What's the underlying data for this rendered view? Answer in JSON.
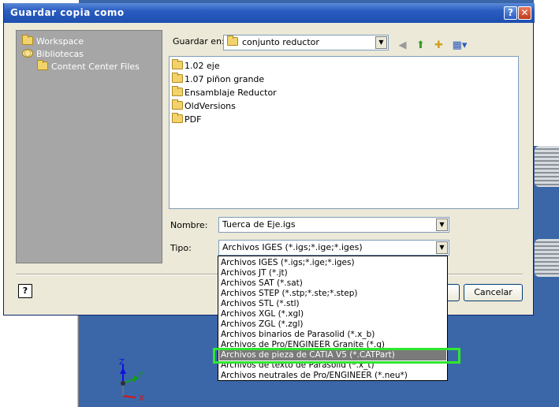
{
  "dialog": {
    "title": "Guardar copia como",
    "help_title_glyph": "?",
    "close_title_glyph": "✕"
  },
  "places": [
    {
      "label": "Workspace",
      "icon": "folder-icon"
    },
    {
      "label": "Bibliotecas",
      "icon": "library-icon"
    },
    {
      "label": "Content Center Files",
      "icon": "folder-icon"
    }
  ],
  "save_in": {
    "label": "Guardar en:",
    "value": "conjunto reductor"
  },
  "toolbar": {
    "back_icon": "back-arrow-icon",
    "up_icon": "up-folder-icon",
    "new_folder_icon": "new-folder-icon",
    "views_icon": "views-menu-icon"
  },
  "files": [
    {
      "name": "1.02 eje"
    },
    {
      "name": "1.07 piñon grande"
    },
    {
      "name": "Ensamblaje Reductor"
    },
    {
      "name": "OldVersions"
    },
    {
      "name": "PDF"
    }
  ],
  "name_field": {
    "label": "Nombre:",
    "value": "Tuerca de Eje.igs"
  },
  "type_field": {
    "label": "Tipo:",
    "value": "Archivos IGES (*.igs;*.ige;*.iges)"
  },
  "type_options": [
    "Archivos IGES (*.igs;*.ige;*.iges)",
    "Archivos JT (*.jt)",
    "Archivos SAT (*.sat)",
    "Archivos STEP (*.stp;*.ste;*.step)",
    "Archivos STL (*.stl)",
    "Archivos XGL (*.xgl)",
    "Archivos ZGL (*.zgl)",
    "Archivos binarios de Parasolid (*.x_b)",
    "Archivos de Pro/ENGINEER Granite (*.g)",
    "Archivos de pieza de CATIA V5 (*.CATPart)",
    "Archivos de texto de Parasolid (*.x_t)",
    "Archivos neutrales de Pro/ENGINEER (*.neu*)"
  ],
  "selected_type_index": 9,
  "buttons": {
    "help": "?",
    "cancel": "Cancelar"
  },
  "triad": {
    "z": "Z",
    "y": "Y",
    "x": "X"
  },
  "colors": {
    "title_bar": "#2a5bc0",
    "highlight": "#2ee82e",
    "selection": "#7a7a7a",
    "canvas": "#3b67a8"
  }
}
